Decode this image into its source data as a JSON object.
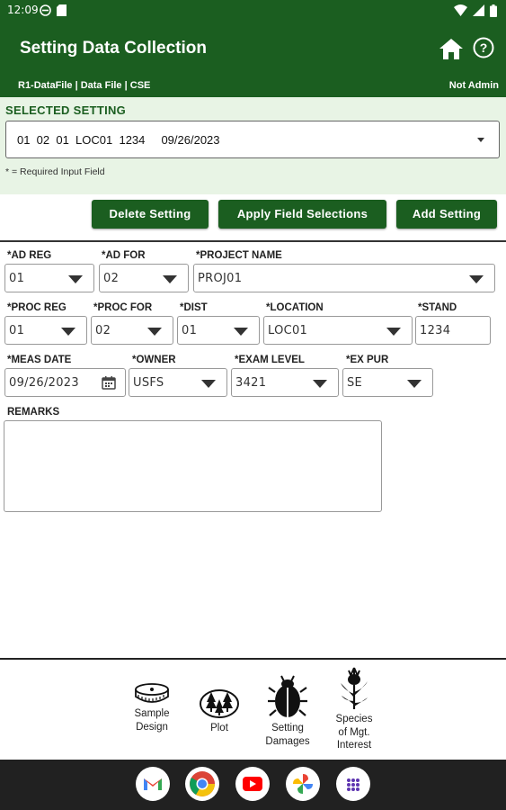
{
  "status_bar": {
    "time": "12:09"
  },
  "app_bar": {
    "title": "Setting Data Collection",
    "subtitle": "R1-DataFile | Data File | CSE",
    "user_role": "Not Admin"
  },
  "selected_setting": {
    "label": "SELECTED SETTING",
    "value": "01  02  01  LOC01  1234     09/26/2023",
    "required_note": "* = Required Input Field"
  },
  "buttons": {
    "delete": "Delete Setting",
    "apply": "Apply Field Selections",
    "add": "Add Setting"
  },
  "form": {
    "ad_reg": {
      "label": "*AD REG",
      "value": "01"
    },
    "ad_for": {
      "label": "*AD FOR",
      "value": "02"
    },
    "project_name": {
      "label": "*PROJECT NAME",
      "value": "PROJ01"
    },
    "proc_reg": {
      "label": "*PROC REG",
      "value": "01"
    },
    "proc_for": {
      "label": "*PROC FOR",
      "value": "02"
    },
    "dist": {
      "label": "*DIST",
      "value": "01"
    },
    "location": {
      "label": "*LOCATION",
      "value": "LOC01"
    },
    "stand": {
      "label": "*STAND",
      "value": "1234"
    },
    "meas_date": {
      "label": "*MEAS DATE",
      "value": "09/26/2023"
    },
    "owner": {
      "label": "*OWNER",
      "value": "USFS"
    },
    "exam_level": {
      "label": "*EXAM LEVEL",
      "value": "3421"
    },
    "ex_pur": {
      "label": "*EX PUR",
      "value": "SE"
    },
    "remarks": {
      "label": "REMARKS",
      "value": ""
    }
  },
  "bottom_nav": [
    {
      "lines": [
        "Sample",
        "Design"
      ],
      "icon": "tape-measure-icon"
    },
    {
      "lines": [
        "Plot"
      ],
      "icon": "trees-plot-icon"
    },
    {
      "lines": [
        "Setting",
        "Damages"
      ],
      "icon": "beetle-icon"
    },
    {
      "lines": [
        "Species",
        "of Mgt.",
        "Interest"
      ],
      "icon": "thistle-icon"
    }
  ],
  "dock_apps": [
    "gmail-icon",
    "chrome-icon",
    "youtube-icon",
    "photos-icon",
    "app-drawer-icon"
  ],
  "colors": {
    "primary": "#1b5e20",
    "panel": "#e8f4e5",
    "dock": "#212121"
  }
}
